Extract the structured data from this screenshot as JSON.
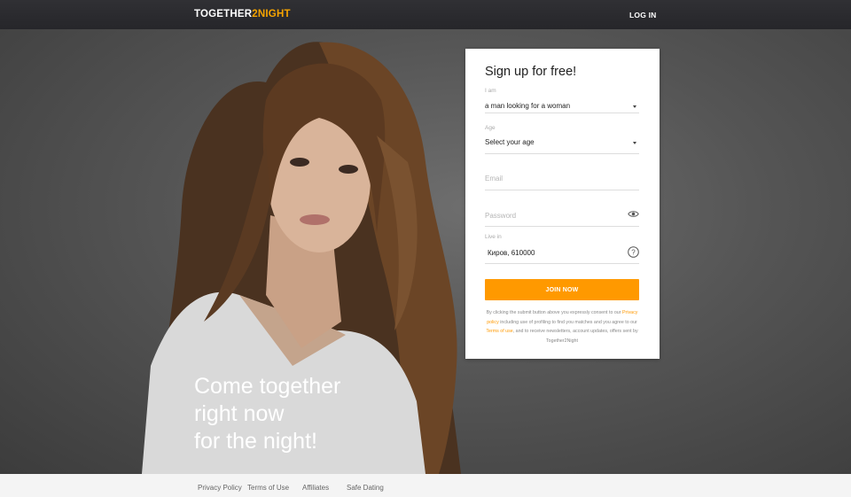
{
  "header": {
    "logo_main": "TOGETHER",
    "logo_accent": "2NIGHT",
    "login_label": "LOG IN"
  },
  "hero": {
    "tagline": [
      "Come together",
      "right now",
      "for the night!"
    ]
  },
  "signup": {
    "title": "Sign up for free!",
    "i_am_label": "I am",
    "i_am_value": "a man looking for a woman",
    "age_label": "Age",
    "age_value": "Select your age",
    "email_placeholder": "Email",
    "password_placeholder": "Password",
    "live_in_label": "Live in",
    "live_in_value": "Киров, 610000",
    "join_label": "JOIN NOW",
    "legal_1": "By clicking the submit button above you expressly consent to our",
    "legal_privacy": "Privacy policy",
    "legal_2": "including use of profiling to find you matches and you agree to our",
    "legal_terms": "Terms of use",
    "legal_3": ", and to receive newsletters, account updates, offers sent by Together2Night"
  },
  "footer": {
    "links": [
      "Privacy Policy",
      "Terms of Use",
      "Affiliates",
      "Safe Dating"
    ]
  },
  "colors": {
    "accent": "#ff9900",
    "topbar": "#2c2c30",
    "background": "#555555"
  }
}
